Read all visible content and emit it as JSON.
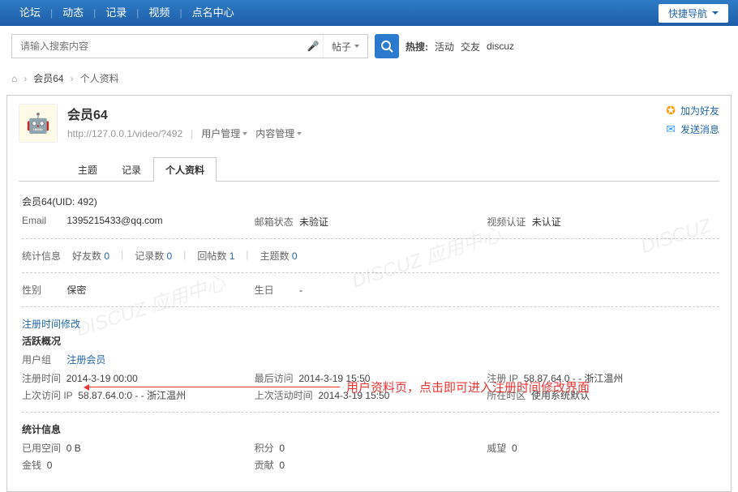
{
  "topnav": {
    "items": [
      "论坛",
      "动态",
      "记录",
      "视频",
      "点名中心"
    ],
    "quicknav": "快捷导航"
  },
  "search": {
    "placeholder": "请输入搜索内容",
    "post_select": "帖子",
    "hot_label": "热搜:",
    "hot_items": [
      "活动",
      "交友",
      "discuz"
    ]
  },
  "breadcrumb": {
    "user": "会员64",
    "page": "个人资料"
  },
  "profile": {
    "name": "会员64",
    "url": "http://127.0.0.1/video/?492",
    "mgmt1": "用户管理",
    "mgmt2": "内容管理",
    "action_addfriend": "加为好友",
    "action_sendmsg": "发送消息"
  },
  "tabs": [
    "主题",
    "记录",
    "个人资料"
  ],
  "info": {
    "uidline": "会员64(UID: 492)",
    "email_lbl": "Email",
    "email_val": "1395215433@qq.com",
    "mailstatus_lbl": "邮箱状态",
    "mailstatus_val": "未验证",
    "videocert_lbl": "视频认证",
    "videocert_val": "未认证",
    "stats_lbl": "统计信息",
    "friends_lbl": "好友数",
    "friends_val": "0",
    "records_lbl": "记录数",
    "records_val": "0",
    "replies_lbl": "回帖数",
    "replies_val": "1",
    "topics_lbl": "主题数",
    "topics_val": "0",
    "gender_lbl": "性别",
    "gender_val": "保密",
    "birthday_lbl": "生日",
    "birthday_val": "-",
    "editreg": "注册时间修改",
    "activity_title": "活跃概况",
    "usergroup_lbl": "用户组",
    "usergroup_val": "注册会员",
    "regtime_lbl": "注册时间",
    "regtime_val": "2014-3-19 00:00",
    "lastvisit_lbl": "最后访问",
    "lastvisit_val": "2014-3-19 15:50",
    "regip_lbl": "注册 IP",
    "regip_val": "58.87.64.0 - - 浙江温州",
    "lastip_lbl": "上次访问 IP",
    "lastip_val": "58.87.64.0:0 - - 浙江温州",
    "lastact_lbl": "上次活动时间",
    "lastact_val": "2014-3-19 15:50",
    "tz_lbl": "所在时区",
    "tz_val": "使用系统默认",
    "stats_title": "统计信息",
    "space_lbl": "已用空间",
    "space_val": "0 B",
    "credits_lbl": "积分",
    "credits_val": "0",
    "prestige_lbl": "威望",
    "prestige_val": "0",
    "money_lbl": "金钱",
    "money_val": "0",
    "contrib_lbl": "贡献",
    "contrib_val": "0"
  },
  "annotation": "用户资料页，点击即可进入注册时间修改界面"
}
